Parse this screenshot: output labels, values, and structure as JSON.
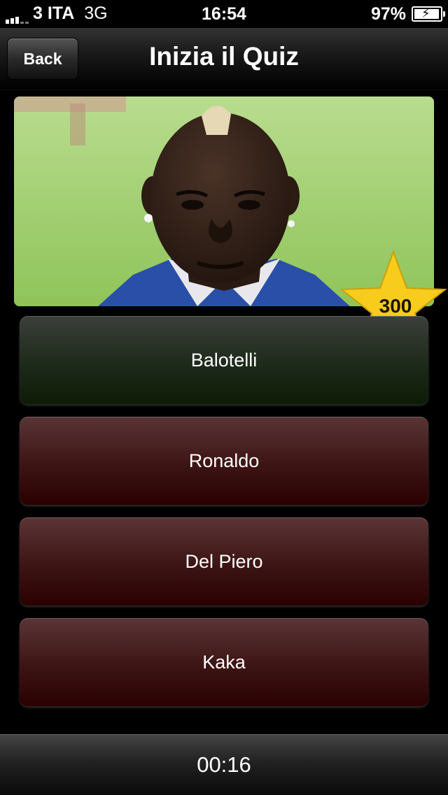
{
  "status_bar": {
    "carrier": "3 ITA",
    "network": "3G",
    "time": "16:54",
    "battery_percent": "97%",
    "battery_level": 0.97
  },
  "nav": {
    "back_label": "Back",
    "title": "Inizia il Quiz"
  },
  "photo": {
    "icon": "player-photo"
  },
  "points": {
    "value": "300",
    "icon": "star-icon",
    "color": "#F7CC1C"
  },
  "answers": [
    {
      "label": "Balotelli",
      "state": "correct",
      "color": "#1e2a1a"
    },
    {
      "label": "Ronaldo",
      "state": "wrong",
      "color": "#3d1414"
    },
    {
      "label": "Del Piero",
      "state": "wrong",
      "color": "#3d1414"
    },
    {
      "label": "Kaka",
      "state": "wrong",
      "color": "#3d1414"
    }
  ],
  "footer": {
    "timer": "00:16"
  }
}
